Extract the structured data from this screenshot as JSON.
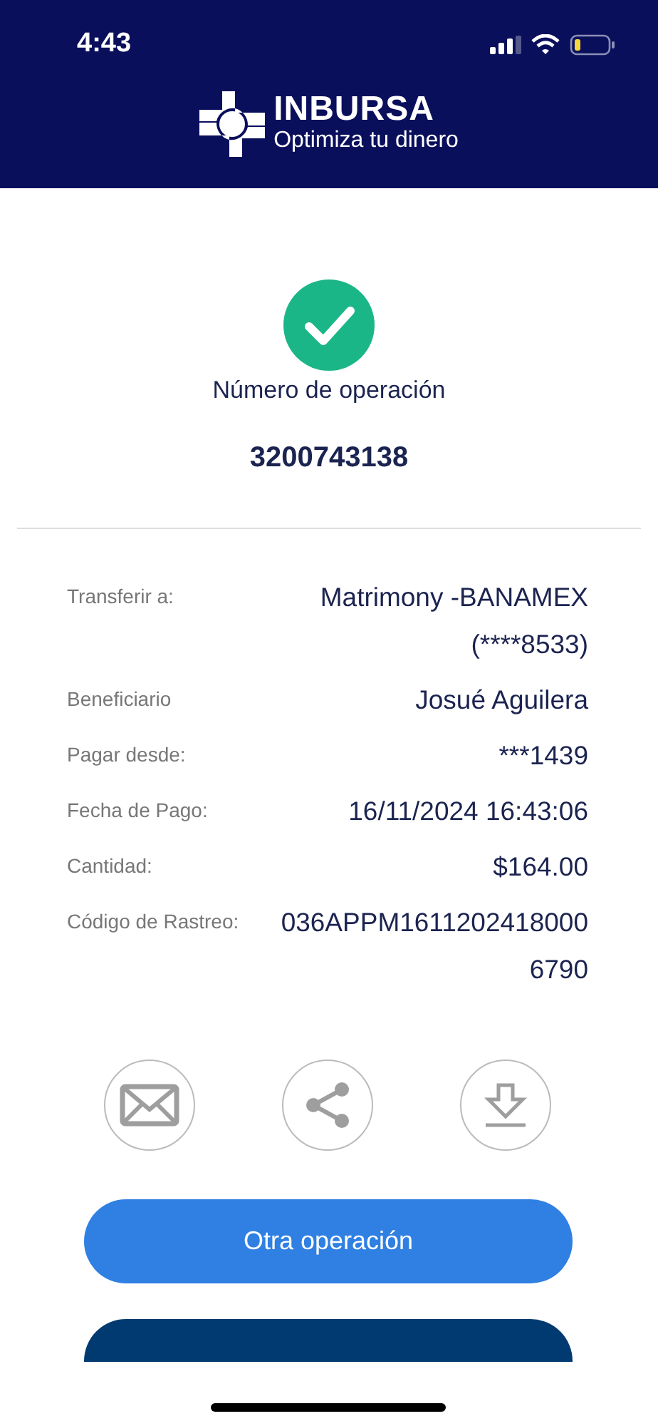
{
  "status_bar": {
    "time": "4:43"
  },
  "header": {
    "brand": "INBURSA",
    "tagline": "Optimiza tu dinero"
  },
  "operation": {
    "label": "Número de operación",
    "number": "3200743138"
  },
  "details": [
    {
      "label": "Transferir a:",
      "value_lines": [
        "Matrimony -BANAMEX",
        "(****8533)"
      ]
    },
    {
      "label": "Beneficiario",
      "value_lines": [
        "Josué Aguilera"
      ]
    },
    {
      "label": "Pagar desde:",
      "value_lines": [
        "***1439"
      ]
    },
    {
      "label": "Fecha de Pago:",
      "value_lines": [
        "16/11/2024 16:43:06"
      ]
    },
    {
      "label": "Cantidad:",
      "value_lines": [
        "$164.00"
      ]
    },
    {
      "label": "Código de Rastreo:",
      "value_lines": [
        "036APPM1611202418000",
        "6790"
      ]
    }
  ],
  "actions": [
    {
      "kind": "email"
    },
    {
      "kind": "share"
    },
    {
      "kind": "download"
    }
  ],
  "buttons": [
    {
      "label": "Otra operación",
      "kind": "primary"
    },
    {
      "kind": "secondary"
    }
  ]
}
